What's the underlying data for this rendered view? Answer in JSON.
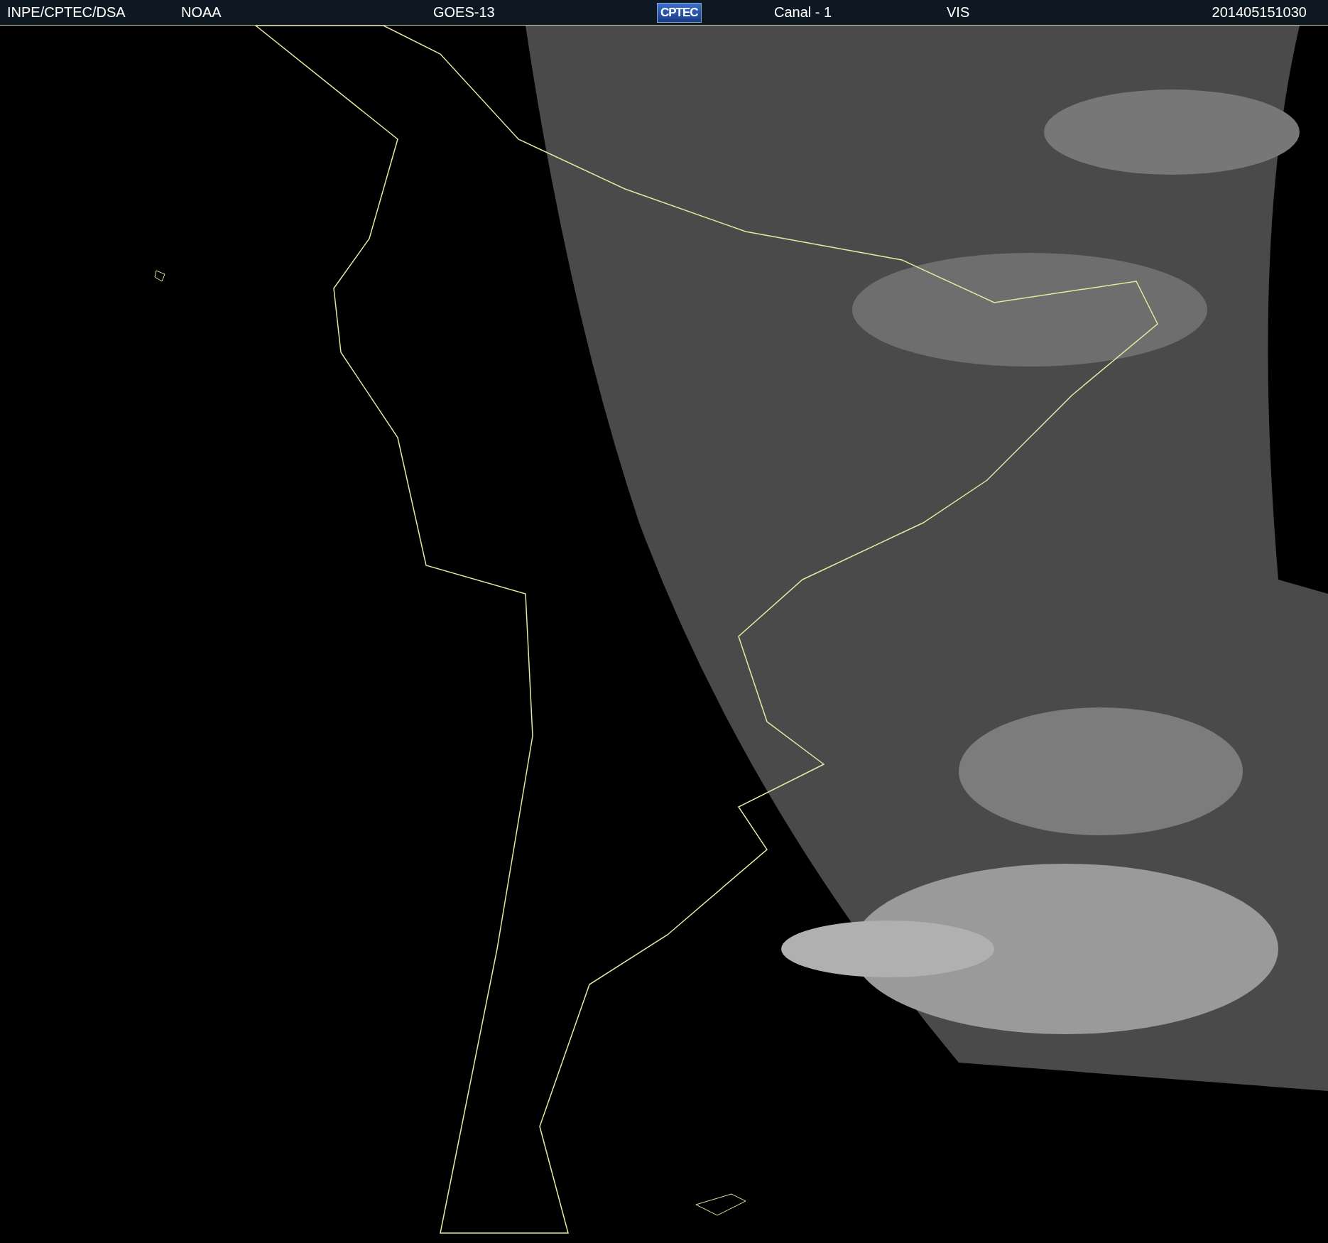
{
  "header": {
    "institution": "INPE/CPTEC/DSA",
    "agency": "NOAA",
    "satellite": "GOES-13",
    "logo_text": "CPTEC",
    "channel": "Canal - 1",
    "band": "VIS",
    "timestamp": "201405151030"
  }
}
